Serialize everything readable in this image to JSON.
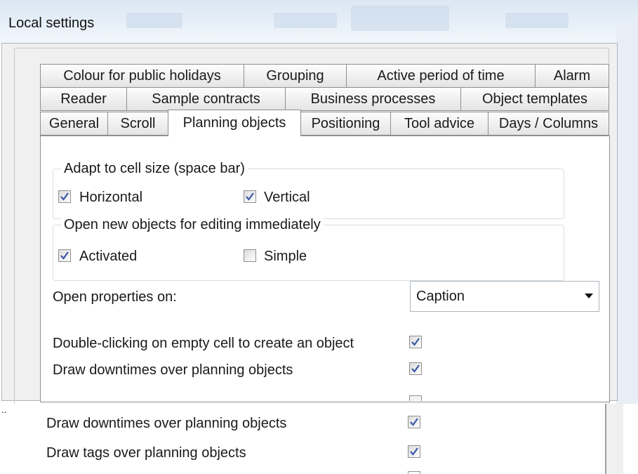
{
  "window": {
    "title": "Local settings"
  },
  "tabs": {
    "row1": [
      "Colour for public holidays",
      "Grouping",
      "Active period of time",
      "Alarm"
    ],
    "row2": [
      "Reader",
      "Sample contracts",
      "Business processes",
      "Object templates"
    ],
    "row3": [
      "General",
      "Scroll",
      "Planning objects",
      "Positioning",
      "Tool advice",
      "Days / Columns"
    ],
    "active": "Planning objects"
  },
  "adapt_group": {
    "legend": "Adapt to cell size (space bar)",
    "horizontal": {
      "label": "Horizontal",
      "checked": true
    },
    "vertical": {
      "label": "Vertical",
      "checked": true
    }
  },
  "open_group": {
    "legend": "Open new objects for editing immediately",
    "activated": {
      "label": "Activated",
      "checked": true
    },
    "simple": {
      "label": "Simple",
      "checked": false
    }
  },
  "open_properties": {
    "label": "Open properties on:",
    "value": "Caption"
  },
  "options": [
    {
      "label": "Double-clicking on empty cell to create an object",
      "checked": true
    },
    {
      "label": "Draw downtimes over planning objects",
      "checked": true
    }
  ],
  "zoomed": {
    "marker": "..",
    "options": [
      {
        "label": "Draw downtimes over planning objects",
        "checked": true
      },
      {
        "label": "Draw tags over planning objects",
        "checked": true
      }
    ]
  }
}
